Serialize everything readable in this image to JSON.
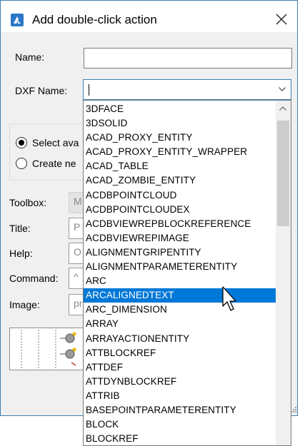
{
  "window": {
    "title": "Add double-click action",
    "icon": "app-logo-icon",
    "close_icon": "close-icon"
  },
  "form": {
    "name_label": "Name:",
    "name_value": "",
    "dxf_label": "DXF Name:",
    "dxf_value": "",
    "radio_select_label": "Select ava",
    "radio_create_label": "Create ne",
    "toolbox_label": "Toolbox:",
    "toolbox_value": "M",
    "title_label": "Title:",
    "title_value": "P",
    "help_label": "Help:",
    "help_value": "O",
    "command_label": "Command:",
    "command_value": "^",
    "image_label": "Image:",
    "image_value": "pr"
  },
  "dropdown": {
    "selected_index": 13,
    "items": [
      "3DFACE",
      "3DSOLID",
      "ACAD_PROXY_ENTITY",
      "ACAD_PROXY_ENTITY_WRAPPER",
      "ACAD_TABLE",
      "ACAD_ZOMBIE_ENTITY",
      "ACDBPOINTCLOUD",
      "ACDBPOINTCLOUDEX",
      "ACDBVIEWREPBLOCKREFERENCE",
      "ACDBVIEWREPIMAGE",
      "ALIGNMENTGRIPENTITY",
      "ALIGNMENTPARAMETERENTITY",
      "ARC",
      "ARCALIGNEDTEXT",
      "ARC_DIMENSION",
      "ARRAY",
      "ARRAYACTIONENTITY",
      "ATTBLOCKREF",
      "ATTDEF",
      "ATTDYNBLOCKREF",
      "ATTRIB",
      "BASEPOINTPARAMETERENTITY",
      "BLOCK",
      "BLOCKREF"
    ]
  },
  "colors": {
    "selection": "#0078d7",
    "accent_border": "#3c7fb1",
    "dialog_bg": "#f0f0f0"
  }
}
